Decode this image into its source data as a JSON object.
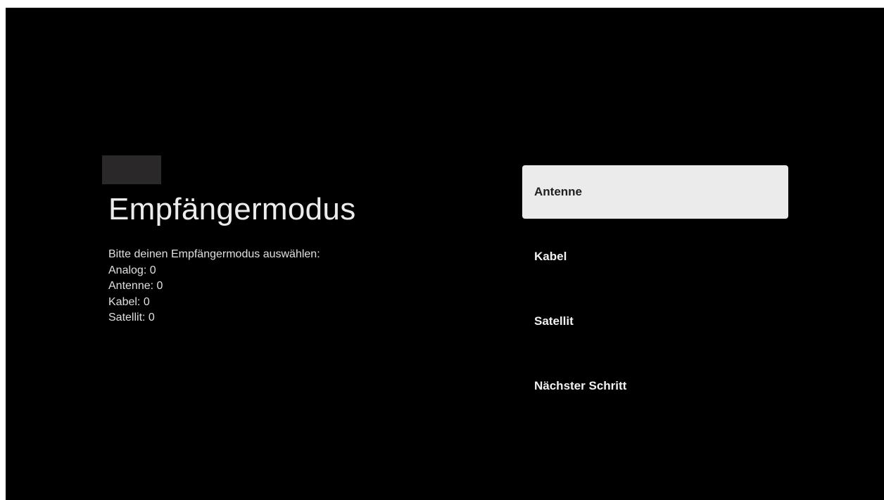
{
  "title": "Empfängermodus",
  "description": {
    "prompt": "Bitte deinen Empfängermodus auswählen:",
    "lines": [
      "Analog: 0",
      "Antenne: 0",
      "Kabel: 0",
      "Satellit: 0"
    ]
  },
  "menu": {
    "items": [
      {
        "label": "Antenne",
        "focused": true
      },
      {
        "label": "Kabel",
        "focused": false
      },
      {
        "label": "Satellit",
        "focused": false
      },
      {
        "label": "Nächster Schritt",
        "focused": false
      }
    ]
  },
  "colors": {
    "background": "#000000",
    "focus_background": "#ebebeb",
    "focus_text": "#202020",
    "text": "#ffffff"
  }
}
